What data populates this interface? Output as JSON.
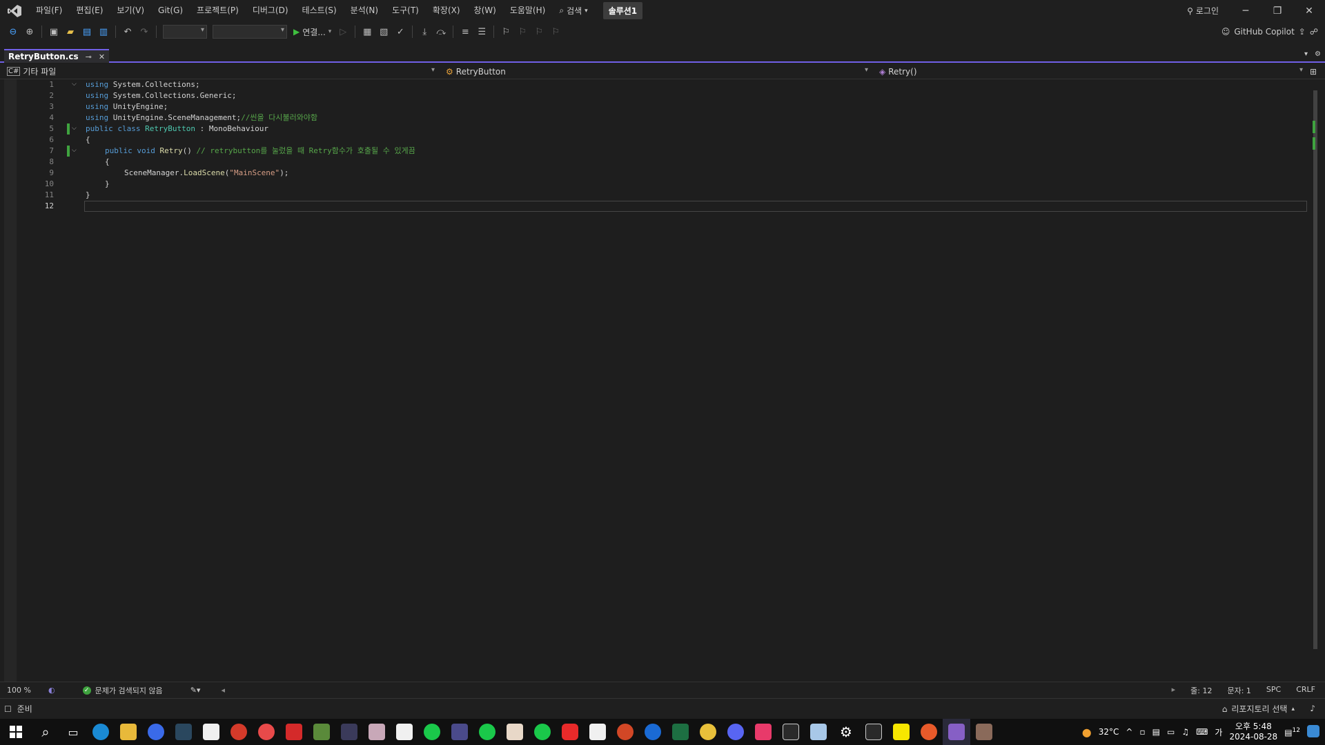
{
  "titlebar": {
    "menu": [
      "파일(F)",
      "편집(E)",
      "보기(V)",
      "Git(G)",
      "프로젝트(P)",
      "디버그(D)",
      "테스트(S)",
      "분석(N)",
      "도구(T)",
      "확장(X)",
      "창(W)",
      "도움말(H)"
    ],
    "search_label": "검색",
    "solution": "솔루션1",
    "login": "로그인"
  },
  "toolbar": {
    "run_label": "연결...",
    "copilot_label": "GitHub Copilot"
  },
  "tab": {
    "label": "RetryButton.cs"
  },
  "navbar": {
    "project": "기타 파일",
    "class": "RetryButton",
    "member": "Retry()"
  },
  "editor": {
    "line_numbers": [
      "1",
      "2",
      "3",
      "4",
      "5",
      "6",
      "7",
      "8",
      "9",
      "10",
      "11",
      "12"
    ],
    "lines": {
      "l1": [
        "using",
        " System.Collections;"
      ],
      "l2": [
        "using",
        " System.Collections.Generic;"
      ],
      "l3": [
        "using",
        " UnityEngine;"
      ],
      "l4": [
        "using",
        " UnityEngine.SceneManagement;",
        "//씬을 다시불러와야함"
      ],
      "l5": [
        "public",
        " ",
        "class",
        " ",
        "RetryButton",
        " : MonoBehaviour"
      ],
      "l6": [
        "{"
      ],
      "l7": [
        "public",
        " ",
        "void",
        " ",
        "Retry",
        "() ",
        "// retrybutton를 눌렀을 때 Retry함수가 호출될 수 있게끔"
      ],
      "l8": [
        "{"
      ],
      "l9": [
        "SceneManager.",
        "LoadScene",
        "(",
        "\"MainScene\"",
        ");"
      ],
      "l10": [
        "}"
      ],
      "l11": [
        "}"
      ]
    }
  },
  "status": {
    "zoom": "100 %",
    "issues": "문제가 검색되지 않음",
    "line": "줄: 12",
    "col": "문자: 1",
    "spc": "SPC",
    "crlf": "CRLF",
    "ready": "준비",
    "repo": "리포지토리 선택"
  },
  "taskbar": {
    "temperature": "32°C",
    "ime": "가",
    "time": "오후 5:48",
    "date": "2024-08-28",
    "notifications": "12"
  }
}
